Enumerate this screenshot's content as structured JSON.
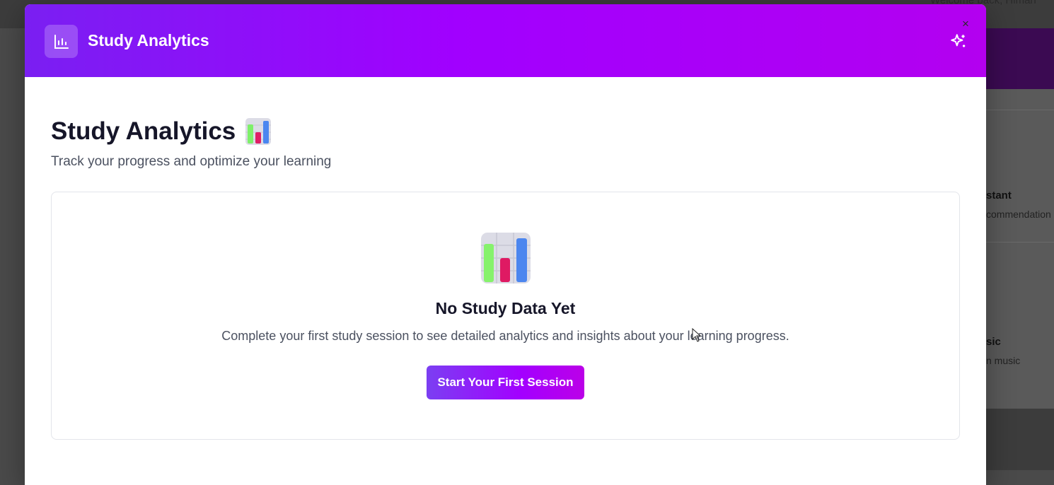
{
  "background": {
    "welcome_text": "Welcome back, Himan",
    "items": [
      {
        "title": "stant",
        "subtitle": "commendation"
      },
      {
        "title": "sic",
        "subtitle": "n music"
      }
    ]
  },
  "modal": {
    "header_title": "Study Analytics",
    "header_icon": "bar-chart-icon",
    "sparkle_icon": "sparkle-icon",
    "close_label": "×",
    "page_title": "Study Analytics",
    "page_subtitle": "Track your progress and optimize your learning",
    "empty_state": {
      "title": "No Study Data Yet",
      "text": "Complete your first study session to see detailed analytics and insights about your learning progress.",
      "button_label": "Start Your First Session"
    }
  },
  "colors": {
    "header_gradient_start": "#7a1ff2",
    "header_gradient_end": "#b300f0",
    "button_gradient_start": "#7b3ff2",
    "button_gradient_end": "#bb00e8",
    "title_text": "#161629",
    "body_text": "#4b5160"
  }
}
